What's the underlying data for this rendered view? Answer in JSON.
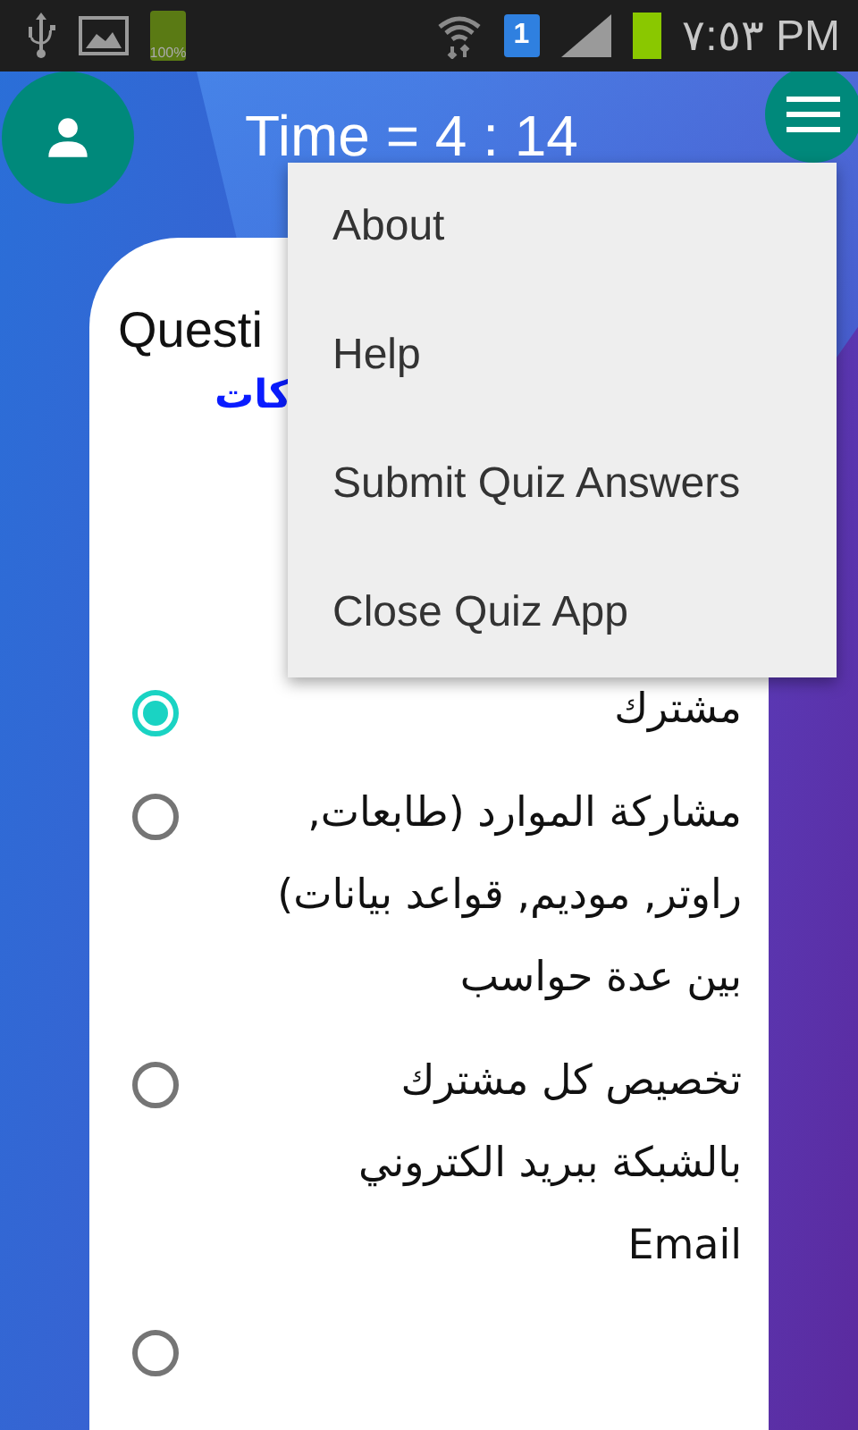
{
  "status_bar": {
    "battery_label": "100%",
    "sim_slot": "1",
    "time": "٧:٥٣ PM"
  },
  "header": {
    "title": "Time = 4 : 14"
  },
  "question": {
    "title": "Questi",
    "text": "كات"
  },
  "options": [
    {
      "text": "مشترك",
      "selected": true
    },
    {
      "text": "مشاركة الموارد (طابعات, راوتر, موديم, قواعد بيانات) بين عدة حواسب",
      "selected": false
    },
    {
      "text": "تخصيص كل مشترك بالشبكة ببريد الكتروني Email",
      "selected": false
    }
  ],
  "partial_option": {
    "selected": false
  },
  "menu": {
    "items": [
      "About",
      "Help",
      "Submit Quiz Answers",
      "Close Quiz App"
    ]
  }
}
